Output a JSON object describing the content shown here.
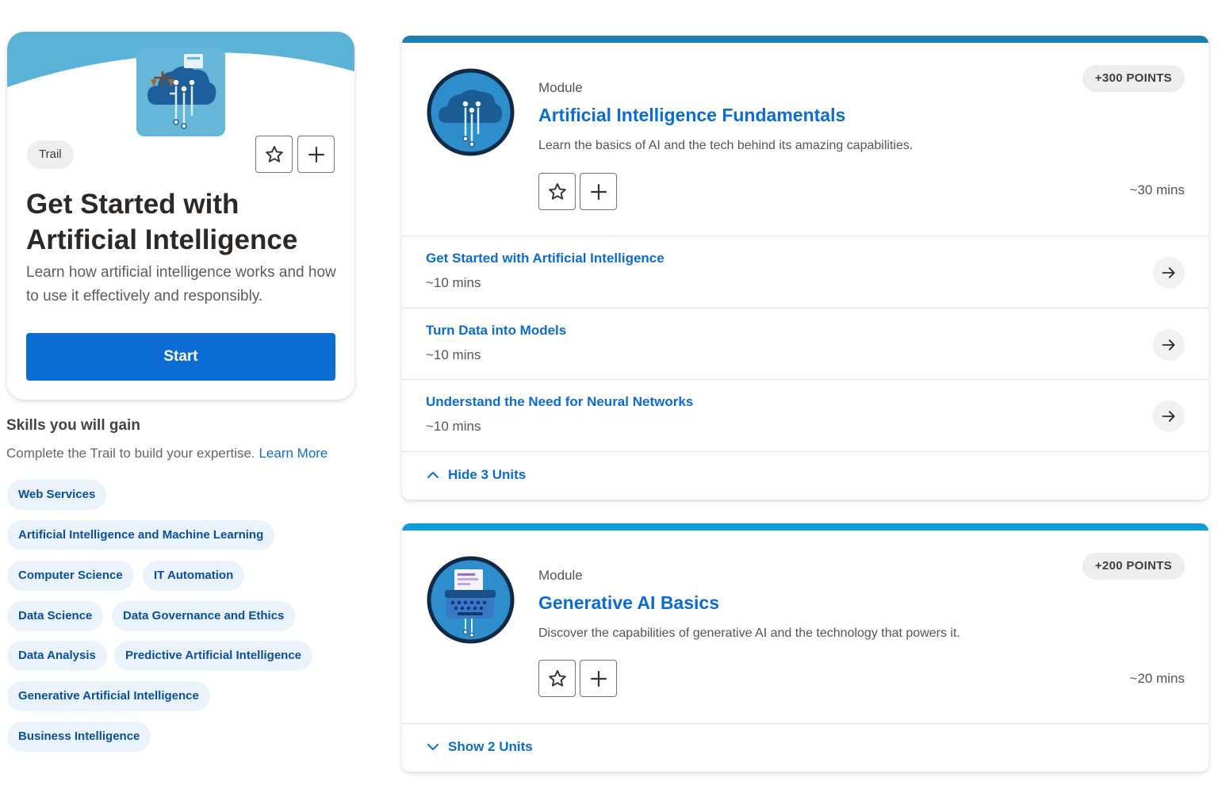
{
  "trail": {
    "badge": "Trail",
    "title": "Get Started with Artificial Intelligence",
    "description": "Learn how artificial intelligence works and how to use it effectively and responsibly.",
    "start_label": "Start",
    "icons": [
      "star-icon",
      "plus-icon"
    ]
  },
  "skills": {
    "title": "Skills you will gain",
    "subtitle": "Complete the Trail to build your expertise.",
    "learn_more": "Learn More",
    "items": [
      "Web Services",
      "Artificial Intelligence and Machine Learning",
      "Computer Science",
      "IT Automation",
      "Data Science",
      "Data Governance and Ethics",
      "Data Analysis",
      "Predictive Artificial Intelligence",
      "Generative Artificial Intelligence",
      "Business Intelligence"
    ]
  },
  "modules": [
    {
      "label": "Module",
      "title": "Artificial Intelligence Fundamentals",
      "description": "Learn the basics of AI and the tech behind its amazing capabilities.",
      "points": "+300 POINTS",
      "duration": "~30 mins",
      "units": [
        {
          "title": "Get Started with Artificial Intelligence",
          "duration": "~10 mins"
        },
        {
          "title": "Turn Data into Models",
          "duration": "~10 mins"
        },
        {
          "title": "Understand the Need for Neural Networks",
          "duration": "~10 mins"
        }
      ],
      "toggle_label": "Hide 3 Units"
    },
    {
      "label": "Module",
      "title": "Generative AI Basics",
      "description": "Discover the capabilities of generative AI and the technology that powers it.",
      "points": "+200 POINTS",
      "duration": "~20 mins",
      "toggle_label": "Show 2 Units"
    }
  ],
  "colors": {
    "brand_blue": "#0b6cd4",
    "pill_bg": "#eaf3fc",
    "banner": "#5ab2d6",
    "module1_bar": "#1a7fb5",
    "module2_bar": "#0d9dd8"
  }
}
